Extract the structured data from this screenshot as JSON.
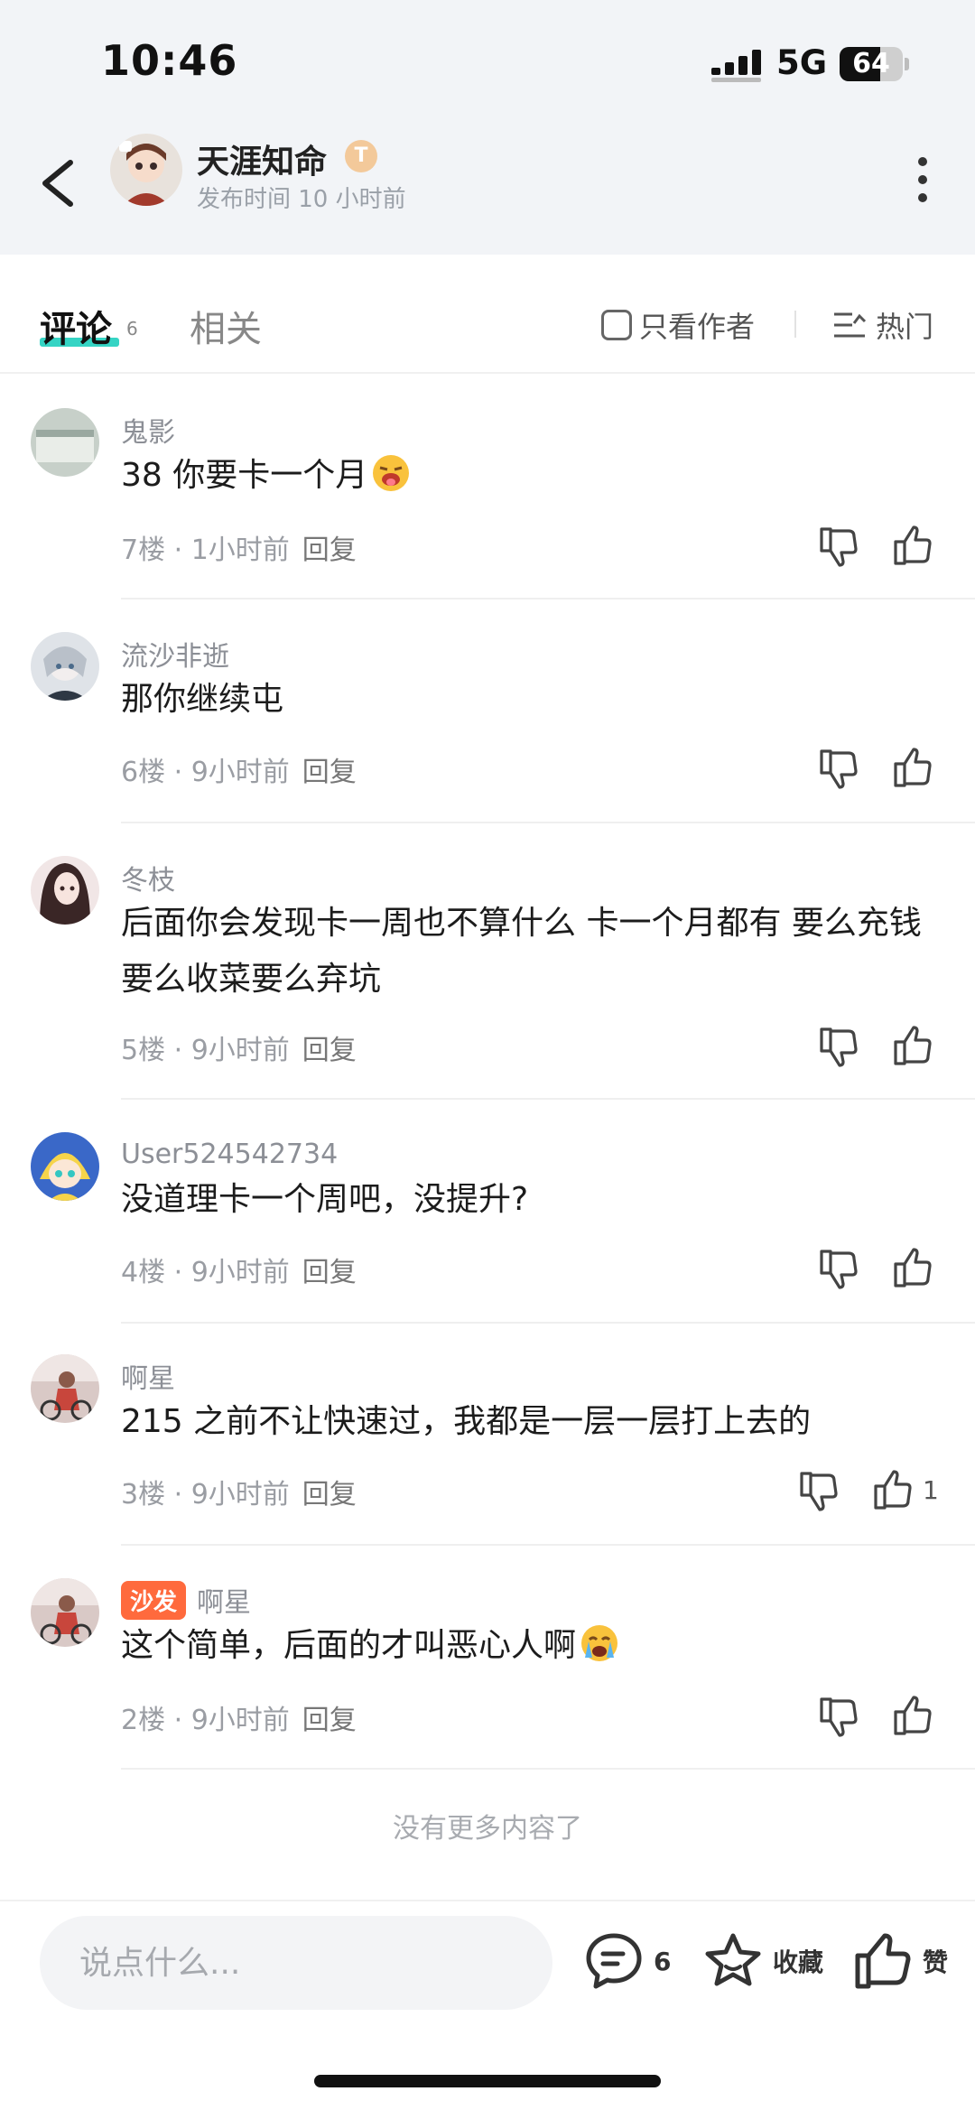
{
  "status_bar": {
    "time": "10:46",
    "network": "5G",
    "battery_level": "64",
    "battery_fraction": 0.64
  },
  "header": {
    "author_name": "天涯知命",
    "badge_letter": "T",
    "post_time": "发布时间 10 小时前"
  },
  "tabs": {
    "comments_label": "评论",
    "comments_count": "6",
    "related_label": "相关",
    "author_only_label": "只看作者",
    "sort_label": "热门"
  },
  "comments": [
    {
      "name": "鬼影",
      "text": "38 你要卡一个月",
      "emoji": "grinning-tongue-emoji",
      "floor": "7楼",
      "time": "1小时前",
      "reply": "回复",
      "likes": ""
    },
    {
      "name": "流沙非逝",
      "text": "那你继续屯",
      "floor": "6楼",
      "time": "9小时前",
      "reply": "回复",
      "likes": ""
    },
    {
      "name": "冬枝",
      "text": "后面你会发现卡一周也不算什么 卡一个月都有 要么充钱要么收菜要么弃坑",
      "floor": "5楼",
      "time": "9小时前",
      "reply": "回复",
      "likes": ""
    },
    {
      "name": "User524542734",
      "text": "没道理卡一个周吧，没提升?",
      "floor": "4楼",
      "time": "9小时前",
      "reply": "回复",
      "likes": ""
    },
    {
      "name": "啊星",
      "text": "215 之前不让快速过，我都是一层一层打上去的",
      "floor": "3楼",
      "time": "9小时前",
      "reply": "回复",
      "likes": "1"
    },
    {
      "name": "啊星",
      "badge": "沙发",
      "text": "这个简单，后面的才叫恶心人啊",
      "emoji": "crying-emoji",
      "floor": "2楼",
      "time": "9小时前",
      "reply": "回复",
      "likes": ""
    }
  ],
  "meta_separator": " · ",
  "footer": {
    "no_more": "没有更多内容了"
  },
  "bottom_bar": {
    "input_placeholder": "说点什么...",
    "comment_count": "6",
    "favorite_label": "收藏",
    "like_label": "赞"
  },
  "colors": {
    "accent_underline": "#35d4c4",
    "sofa_badge": "#ff6a3d",
    "header_bg": "#f2f4f7"
  }
}
